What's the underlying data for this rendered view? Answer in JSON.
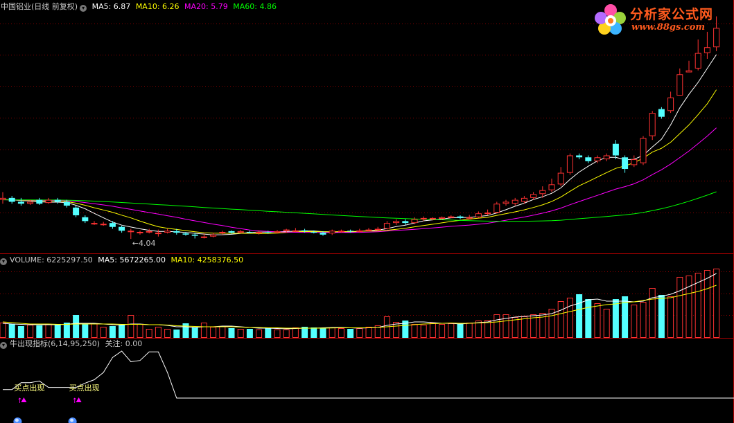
{
  "header_main": {
    "title": "中国铝业(日线 前复权)",
    "ma5": "MA5: 6.87",
    "ma10": "MA10: 6.26",
    "ma20": "MA20: 5.79",
    "ma60": "MA60: 4.86"
  },
  "header_volume": {
    "volume": "VOLUME: 6225297.50",
    "ma5": "MA5: 5672265.00",
    "ma10": "MA10: 4258376.50"
  },
  "header_indicator": {
    "name": "牛出现指标(6,14,95,250)",
    "focus": "关注: 0.00"
  },
  "logo": {
    "title": "分析家公式网",
    "url": "www.88gs.com"
  },
  "colors": {
    "up": "#ff3232",
    "down": "#54ffff",
    "grid": "#8b0000",
    "border": "#b40000",
    "ma5": "#ffffff",
    "ma10": "#ffff00",
    "ma20": "#ff00ff",
    "ma60": "#00ff00",
    "signal": "#ff00ff",
    "signal_text": "#ffff80"
  },
  "chart_data": [
    {
      "type": "candlestick",
      "title": "中国铝业(日线 前复权)",
      "series": [
        {
          "name": "MA5"
        },
        {
          "name": "MA10"
        },
        {
          "name": "MA20"
        },
        {
          "name": "MA60"
        }
      ],
      "annotations": [
        {
          "text": "←4.04",
          "value": 4.04,
          "index": 14
        }
      ],
      "candles": [
        [
          5.05,
          5.1,
          5.25,
          4.95
        ],
        [
          5.1,
          5.0,
          5.15,
          4.95
        ],
        [
          5.0,
          4.95,
          5.1,
          4.9
        ],
        [
          4.95,
          5.0,
          5.05,
          4.92
        ],
        [
          5.05,
          4.95,
          5.1,
          4.92
        ],
        [
          4.97,
          5.05,
          5.1,
          4.95
        ],
        [
          5.05,
          5.0,
          5.1,
          4.95
        ],
        [
          5.0,
          4.9,
          5.05,
          4.85
        ],
        [
          4.85,
          4.65,
          4.9,
          4.6
        ],
        [
          4.6,
          4.5,
          4.65,
          4.45
        ],
        [
          4.42,
          4.45,
          4.5,
          4.4
        ],
        [
          4.42,
          4.43,
          4.48,
          4.38
        ],
        [
          4.45,
          4.35,
          4.5,
          4.3
        ],
        [
          4.35,
          4.25,
          4.38,
          4.2
        ],
        [
          4.22,
          4.25,
          4.3,
          4.04
        ],
        [
          4.2,
          4.22,
          4.25,
          4.15
        ],
        [
          4.22,
          4.24,
          4.3,
          4.18
        ],
        [
          4.2,
          4.2,
          4.28,
          4.1
        ],
        [
          4.2,
          4.25,
          4.3,
          4.18
        ],
        [
          4.24,
          4.2,
          4.3,
          4.15
        ],
        [
          4.18,
          4.15,
          4.22,
          4.12
        ],
        [
          4.15,
          4.12,
          4.2,
          4.05
        ],
        [
          4.1,
          4.1,
          4.18,
          4.05
        ],
        [
          4.1,
          4.15,
          4.2,
          4.08
        ],
        [
          4.2,
          4.22,
          4.25,
          4.15
        ],
        [
          4.24,
          4.2,
          4.26,
          4.17
        ],
        [
          4.2,
          4.24,
          4.27,
          4.18
        ],
        [
          4.22,
          4.21,
          4.25,
          4.18
        ],
        [
          4.2,
          4.22,
          4.26,
          4.15
        ],
        [
          4.22,
          4.2,
          4.25,
          4.18
        ],
        [
          4.2,
          4.24,
          4.27,
          4.18
        ],
        [
          4.24,
          4.28,
          4.3,
          4.2
        ],
        [
          4.25,
          4.26,
          4.32,
          4.22
        ],
        [
          4.26,
          4.24,
          4.3,
          4.2
        ],
        [
          4.22,
          4.2,
          4.26,
          4.18
        ],
        [
          4.2,
          4.15,
          4.24,
          4.12
        ],
        [
          4.18,
          4.25,
          4.28,
          4.14
        ],
        [
          4.24,
          4.25,
          4.28,
          4.2
        ],
        [
          4.25,
          4.24,
          4.28,
          4.2
        ],
        [
          4.22,
          4.26,
          4.3,
          4.2
        ],
        [
          4.27,
          4.28,
          4.32,
          4.24
        ],
        [
          4.28,
          4.3,
          4.35,
          4.25
        ],
        [
          4.3,
          4.45,
          4.5,
          4.28
        ],
        [
          4.45,
          4.5,
          4.55,
          4.4
        ],
        [
          4.5,
          4.45,
          4.55,
          4.4
        ],
        [
          4.45,
          4.55,
          4.6,
          4.42
        ],
        [
          4.55,
          4.58,
          4.62,
          4.5
        ],
        [
          4.56,
          4.58,
          4.6,
          4.52
        ],
        [
          4.56,
          4.6,
          4.62,
          4.54
        ],
        [
          4.6,
          4.62,
          4.65,
          4.58
        ],
        [
          4.62,
          4.58,
          4.65,
          4.55
        ],
        [
          4.6,
          4.6,
          4.66,
          4.55
        ],
        [
          4.6,
          4.7,
          4.75,
          4.58
        ],
        [
          4.7,
          4.72,
          4.8,
          4.65
        ],
        [
          4.72,
          4.95,
          5.0,
          4.7
        ],
        [
          4.95,
          5.0,
          5.05,
          4.9
        ],
        [
          4.95,
          5.05,
          5.1,
          4.9
        ],
        [
          5.0,
          5.1,
          5.15,
          4.95
        ],
        [
          5.1,
          5.2,
          5.25,
          5.05
        ],
        [
          5.2,
          5.3,
          5.4,
          5.1
        ],
        [
          5.3,
          5.45,
          5.6,
          5.25
        ],
        [
          5.45,
          5.75,
          5.9,
          5.4
        ],
        [
          5.75,
          6.2,
          6.25,
          5.7
        ],
        [
          6.2,
          6.15,
          6.25,
          6.1
        ],
        [
          6.15,
          6.05,
          6.2,
          6.0
        ],
        [
          6.05,
          6.15,
          6.2,
          6.0
        ],
        [
          6.1,
          6.2,
          6.25,
          6.05
        ],
        [
          6.5,
          6.2,
          6.6,
          6.1
        ],
        [
          6.15,
          5.85,
          6.2,
          5.75
        ],
        [
          5.95,
          6.1,
          6.2,
          5.9
        ],
        [
          6.0,
          6.65,
          6.7,
          5.95
        ],
        [
          6.7,
          7.3,
          7.35,
          6.6
        ],
        [
          7.4,
          7.2,
          7.45,
          7.15
        ],
        [
          7.35,
          7.7,
          7.85,
          7.3
        ],
        [
          7.75,
          8.3,
          8.45,
          7.75
        ],
        [
          8.35,
          8.4,
          8.65,
          8.35
        ],
        [
          8.45,
          8.85,
          9.2,
          8.4
        ],
        [
          8.85,
          9.0,
          9.4,
          8.7
        ],
        [
          9.0,
          9.5,
          9.8,
          8.9
        ]
      ]
    },
    {
      "type": "bar",
      "title": "VOLUME",
      "series": [
        {
          "name": "MA5"
        },
        {
          "name": "MA10"
        }
      ],
      "values": [
        2.2,
        2.0,
        1.7,
        1.9,
        1.8,
        2.0,
        1.9,
        2.2,
        3.3,
        2.0,
        2.1,
        1.6,
        1.7,
        1.9,
        3.3,
        2.0,
        1.3,
        1.6,
        1.3,
        1.2,
        2.1,
        1.5,
        2.2,
        1.6,
        1.7,
        1.4,
        1.3,
        1.3,
        1.2,
        1.5,
        1.2,
        1.2,
        1.5,
        1.6,
        1.5,
        1.4,
        1.5,
        1.4,
        1.3,
        1.4,
        1.6,
        1.8,
        3.1,
        2.3,
        2.5,
        2.0,
        1.9,
        2.2,
        2.0,
        2.1,
        2.0,
        2.2,
        2.5,
        2.6,
        3.4,
        3.4,
        3.0,
        3.1,
        3.4,
        3.6,
        4.2,
        5.3,
        5.8,
        6.3,
        5.6,
        5.0,
        4.2,
        5.6,
        6.0,
        4.8,
        5.2,
        7.2,
        6.2,
        6.0,
        8.8,
        9.0,
        9.4,
        9.8,
        10.0
      ],
      "ma5": [
        2.1,
        2.0,
        1.95,
        1.9,
        1.9,
        1.9,
        1.9,
        1.95,
        2.1,
        2.1,
        2.1,
        2.0,
        1.9,
        1.85,
        2.0,
        2.0,
        1.9,
        1.9,
        1.8,
        1.6,
        1.6,
        1.5,
        1.6,
        1.6,
        1.7,
        1.7,
        1.6,
        1.5,
        1.4,
        1.4,
        1.35,
        1.3,
        1.35,
        1.4,
        1.4,
        1.45,
        1.5,
        1.5,
        1.45,
        1.4,
        1.45,
        1.5,
        1.8,
        2.0,
        2.1,
        2.3,
        2.3,
        2.2,
        2.1,
        2.1,
        2.0,
        2.1,
        2.2,
        2.3,
        2.6,
        2.8,
        3.0,
        3.1,
        3.2,
        3.3,
        3.5,
        4.0,
        4.6,
        5.0,
        5.5,
        5.6,
        5.3,
        5.3,
        5.3,
        5.2,
        5.3,
        5.8,
        6.0,
        6.3,
        6.8,
        7.4,
        8.0,
        8.6,
        9.3
      ],
      "ma10": [
        2.3,
        2.2,
        2.1,
        2.0,
        2.0,
        2.0,
        1.95,
        1.95,
        2.0,
        2.0,
        2.0,
        2.0,
        2.0,
        1.95,
        1.95,
        1.95,
        1.9,
        1.9,
        1.85,
        1.75,
        1.7,
        1.65,
        1.6,
        1.6,
        1.6,
        1.6,
        1.55,
        1.5,
        1.5,
        1.45,
        1.45,
        1.4,
        1.4,
        1.4,
        1.4,
        1.4,
        1.42,
        1.45,
        1.45,
        1.45,
        1.45,
        1.5,
        1.6,
        1.7,
        1.8,
        1.9,
        2.0,
        2.05,
        2.1,
        2.15,
        2.1,
        2.1,
        2.15,
        2.2,
        2.3,
        2.45,
        2.6,
        2.75,
        2.9,
        3.0,
        3.2,
        3.5,
        3.8,
        4.1,
        4.4,
        4.6,
        4.8,
        4.9,
        5.1,
        5.2,
        5.4,
        5.6,
        5.7,
        5.8,
        6.1,
        6.4,
        6.7,
        7.1,
        7.6
      ]
    },
    {
      "type": "line",
      "title": "牛出现指标(6,14,95,250)",
      "values": [
        20,
        20,
        36,
        36,
        40,
        25,
        25,
        25,
        25,
        35,
        43,
        60,
        95,
        110,
        85,
        88,
        108,
        108,
        60,
        0,
        0,
        0,
        0,
        0,
        0,
        0,
        0,
        0,
        0,
        0,
        0,
        0,
        0,
        0,
        0,
        0,
        0,
        0,
        0,
        0,
        0,
        0,
        0,
        0,
        0,
        0,
        0,
        0,
        0,
        0,
        0,
        0,
        0,
        0,
        0,
        0,
        0,
        0,
        0,
        0,
        0,
        0,
        0,
        0,
        0,
        0,
        0,
        0,
        0,
        0,
        0,
        0,
        0,
        0,
        0,
        0,
        0,
        0,
        0
      ],
      "signals": [
        {
          "index": 2,
          "text": "买点出现"
        },
        {
          "index": 8,
          "text": "买点出现"
        }
      ]
    }
  ]
}
